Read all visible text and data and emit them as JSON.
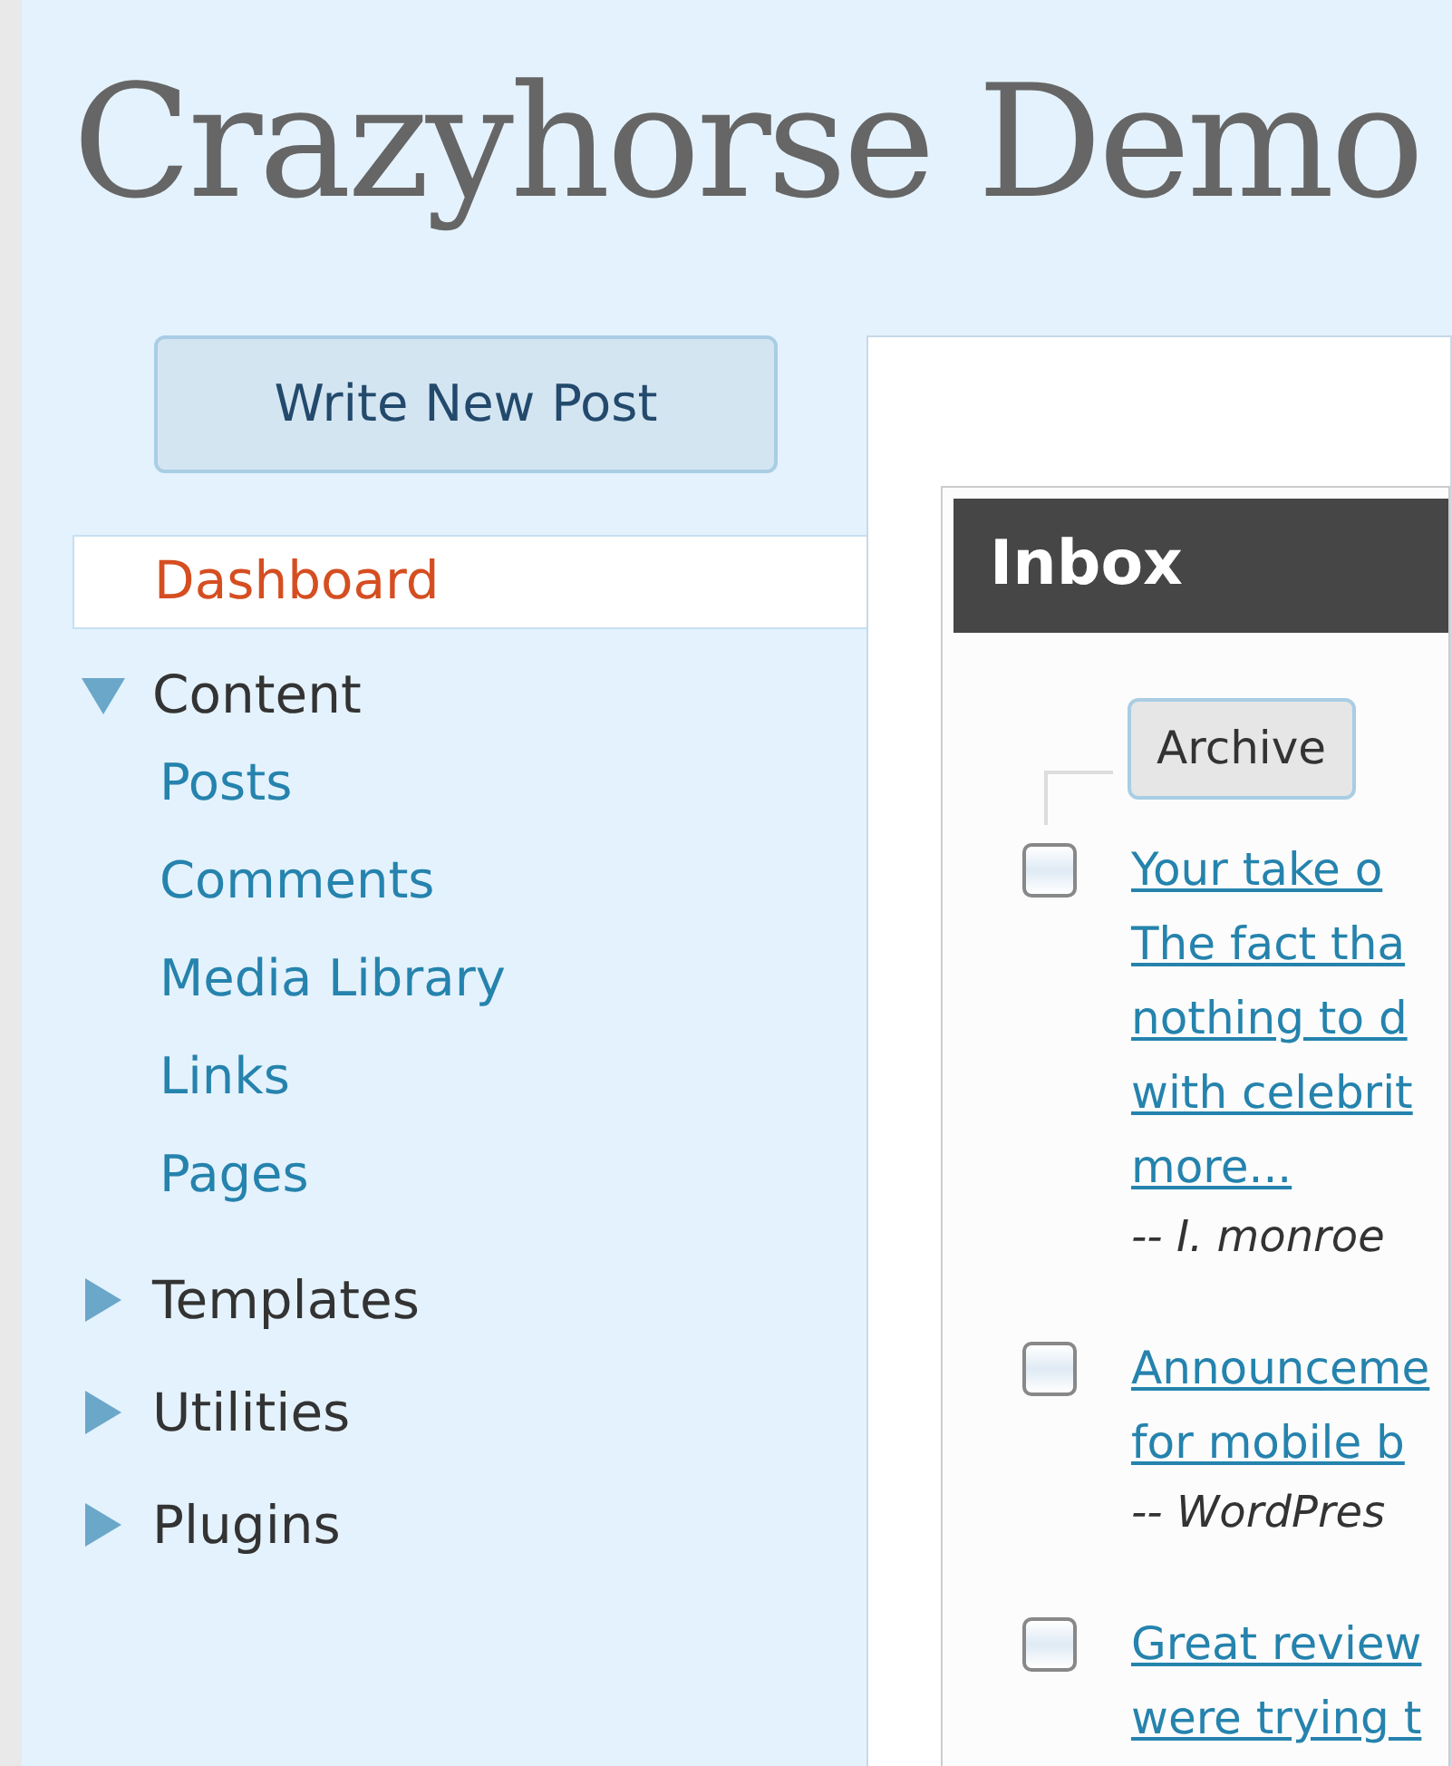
{
  "site_title": "Crazyhorse Demo",
  "write_button": "Write New Post",
  "nav": [
    {
      "label": "Dashboard",
      "kind": "link",
      "selected": true
    },
    {
      "label": "Content",
      "kind": "section",
      "expanded": true,
      "children": [
        {
          "label": "Posts"
        },
        {
          "label": "Comments"
        },
        {
          "label": "Media Library"
        },
        {
          "label": "Links"
        },
        {
          "label": "Pages"
        }
      ]
    },
    {
      "label": "Templates",
      "kind": "section",
      "expanded": false
    },
    {
      "label": "Utilities",
      "kind": "section",
      "expanded": false
    },
    {
      "label": "Plugins",
      "kind": "section",
      "expanded": false
    }
  ],
  "inbox": {
    "title": "Inbox",
    "archive_button": "Archive",
    "items": [
      {
        "checked": false,
        "lines": [
          "Your take o",
          "The fact tha",
          "nothing to d",
          "with celebrit",
          "more..."
        ],
        "author": "-- I. monroe"
      },
      {
        "checked": false,
        "lines": [
          "Announceme",
          "for mobile b"
        ],
        "author": "-- WordPres"
      },
      {
        "checked": false,
        "lines": [
          "Great review",
          "were trying t"
        ]
      }
    ]
  }
}
